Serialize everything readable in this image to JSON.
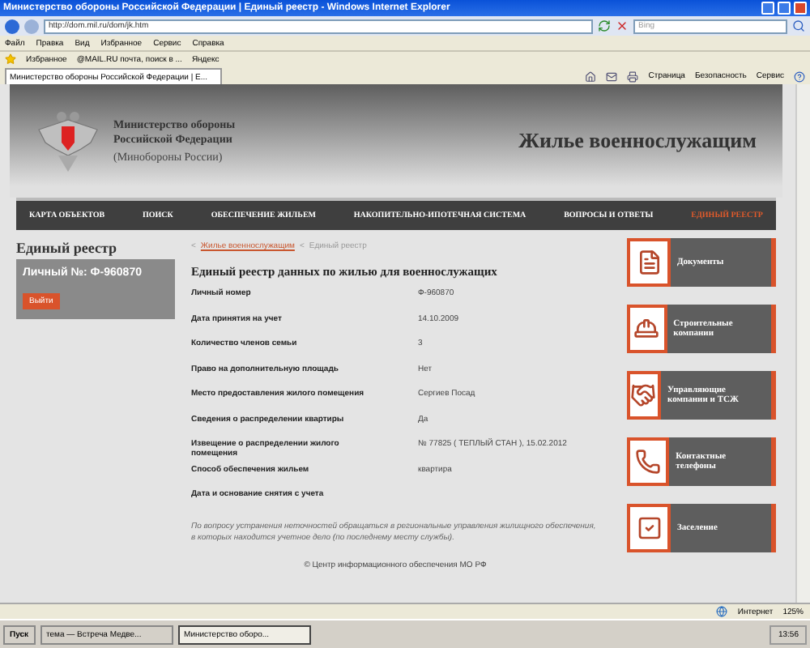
{
  "browser": {
    "title": "Министерство обороны Российской Федерации | Единый реестр - Windows Internet Explorer",
    "address": "http://dom.mil.ru/dom/jk.htm",
    "search_placeholder": "Bing",
    "menu": [
      "Файл",
      "Правка",
      "Вид",
      "Избранное",
      "Сервис",
      "Справка"
    ],
    "favorites_label": "Избранное",
    "favorites": [
      "@MAIL.RU почта, поиск в ...",
      "Яндекс"
    ],
    "tab": "Министерство обороны Российской Федерации | Е...",
    "commands": [
      "Страница",
      "Безопасность",
      "Сервис"
    ]
  },
  "header": {
    "org_lines": [
      "Министерство обороны",
      "Российской Федерации"
    ],
    "org_short": "(Минобороны России)",
    "site_title": "Жилье военнослужащим"
  },
  "nav": [
    {
      "label": "КАРТА ОБЪЕКТОВ",
      "selected": false
    },
    {
      "label": "ПОИСК",
      "selected": false
    },
    {
      "label": "ОБЕСПЕЧЕНИЕ ЖИЛЬЕМ",
      "selected": false
    },
    {
      "label": "НАКОПИТЕЛЬНО-ИПОТЕЧНАЯ СИСТЕМА",
      "selected": false
    },
    {
      "label": "ВОПРОСЫ И ОТВЕТЫ",
      "selected": false
    },
    {
      "label": "ЕДИНЫЙ РЕЕСТР",
      "selected": true
    }
  ],
  "sidebar": {
    "title": "Единый реестр",
    "personal_number": "Личный №: Ф-960870",
    "logout": "Выйти"
  },
  "breadcrumbs": [
    {
      "marker": "<",
      "label": "Жилье военнослужащим",
      "link": true
    },
    {
      "marker": "<",
      "label": "Единый реестр",
      "link": false
    }
  ],
  "main": {
    "heading": "Единый реестр данных по жилью для военнослужащих",
    "rows": [
      {
        "label": "Личный номер",
        "value": "Ф-960870"
      },
      {
        "label": "Дата принятия на учет",
        "value": "14.10.2009"
      },
      {
        "label": "Количество членов семьи",
        "value": "3"
      },
      {
        "label": "Право на дополнительную площадь",
        "value": "Нет"
      },
      {
        "label": "Место предоставления жилого помещения",
        "value": "Сергиев Посад"
      },
      {
        "label": "Сведения о распределении квартиры",
        "value": "Да"
      },
      {
        "label": "Извещение о распределении жилого помещения",
        "value": "№ 77825 ( ТЕПЛЫЙ СТАН ), 15.02.2012"
      },
      {
        "label": "Способ обеспечения жильем",
        "value": "квартира"
      },
      {
        "label": "Дата и основание снятия с учета"
      }
    ],
    "note": "По вопросу устранения неточностей обращаться в региональные управления жилищного обеспечения, в которых находится учетное дело (по последнему месту службы).",
    "footer": "© Центр информационного обеспечения МО РФ"
  },
  "links": [
    {
      "kind": "documents",
      "label": "Документы"
    },
    {
      "kind": "builders",
      "label": "Строительные компании"
    },
    {
      "kind": "management",
      "label": "Управляющие компании и ТСЖ"
    },
    {
      "kind": "phones",
      "label": "Контактные телефоны"
    },
    {
      "kind": "settlement",
      "label": "Заселение"
    }
  ],
  "status": {
    "zone": "Интернет",
    "zoom": "125%"
  },
  "taskbar": {
    "start": "Пуск",
    "tasks": [
      {
        "label": "тема — Встреча Медве...",
        "selected": false
      },
      {
        "label": "Министерство оборо...",
        "selected": true
      }
    ],
    "clock": "13:56"
  }
}
